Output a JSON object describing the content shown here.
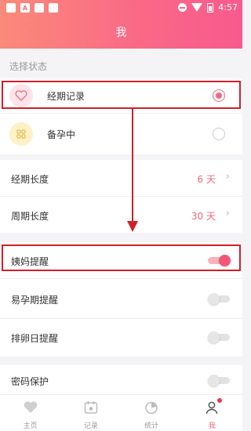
{
  "status_bar": {
    "time": "4:57",
    "icon_a": "A"
  },
  "header": {
    "title": "我"
  },
  "status_section": {
    "label": "选择状态",
    "options": [
      {
        "label": "经期记录",
        "icon": "heart-icon",
        "selected": true
      },
      {
        "label": "备孕中",
        "icon": "baby-footprint-icon",
        "selected": false
      }
    ]
  },
  "settings": {
    "period_length": {
      "label": "经期长度",
      "value": "6 天"
    },
    "cycle_length": {
      "label": "周期长度",
      "value": "30 天"
    }
  },
  "reminders": [
    {
      "label": "姨妈提醒",
      "on": true
    },
    {
      "label": "易孕期提醒",
      "on": false
    },
    {
      "label": "排卵日提醒",
      "on": false
    },
    {
      "label": "密码保护",
      "on": false
    }
  ],
  "tabbar": {
    "items": [
      {
        "label": "主页",
        "icon": "heart-icon",
        "active": false
      },
      {
        "label": "记录",
        "icon": "calendar-icon",
        "active": false
      },
      {
        "label": "统计",
        "icon": "pie-chart-icon",
        "active": false
      },
      {
        "label": "我",
        "icon": "person-icon",
        "active": true
      }
    ]
  },
  "colors": {
    "accent": "#f26a7c",
    "header_start": "#fb8a7a",
    "header_end": "#f85a8e",
    "annotation": "#d11f2a"
  }
}
